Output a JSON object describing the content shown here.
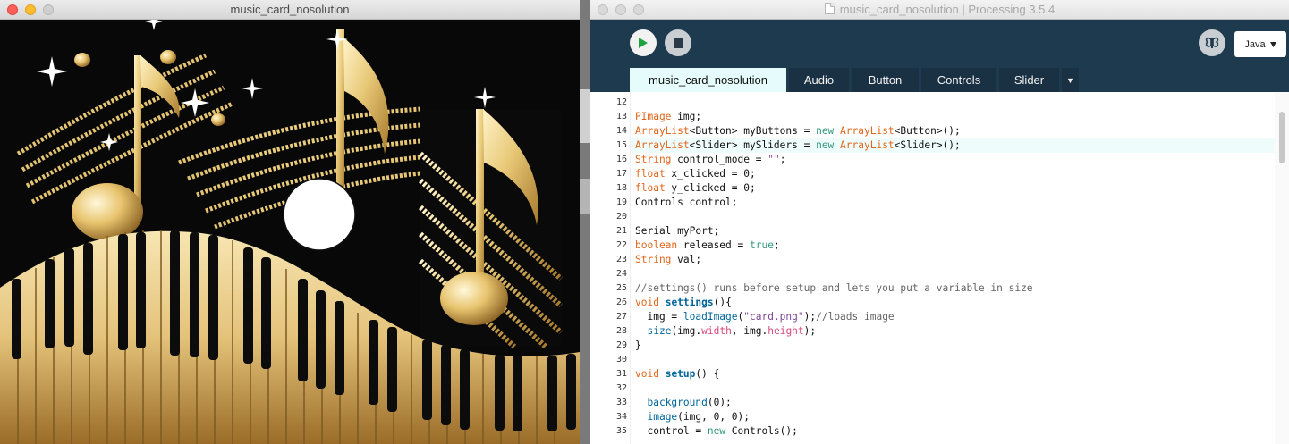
{
  "sketch_window": {
    "title": "music_card_nosolution",
    "canvas": {
      "circle_color": "#ffffff",
      "background_color": "#080808",
      "gold_color": "#e8c978"
    }
  },
  "ide_window": {
    "title": "music_card_nosolution | Processing 3.5.4",
    "toolbar": {
      "run_icon": "play-icon",
      "stop_icon": "stop-icon",
      "debug_icon": "butterfly-debugger-icon",
      "mode_label": "Java",
      "mode_icon": "triangle-down-icon"
    },
    "tabs": [
      {
        "label": "music_card_nosolution",
        "active": true
      },
      {
        "label": "Audio",
        "active": false
      },
      {
        "label": "Button",
        "active": false
      },
      {
        "label": "Controls",
        "active": false
      },
      {
        "label": "Slider",
        "active": false
      }
    ],
    "tab_menu_label": "▼",
    "editor": {
      "highlighted_line": 15,
      "lines": [
        {
          "num": "12",
          "text": ""
        },
        {
          "num": "13",
          "text": "PImage img;"
        },
        {
          "num": "14",
          "text": "ArrayList<Button> myButtons = new ArrayList<Button>();"
        },
        {
          "num": "15",
          "text": "ArrayList<Slider> mySliders = new ArrayList<Slider>();"
        },
        {
          "num": "16",
          "text": "String control_mode = \"\";"
        },
        {
          "num": "17",
          "text": "float x_clicked = 0;"
        },
        {
          "num": "18",
          "text": "float y_clicked = 0;"
        },
        {
          "num": "19",
          "text": "Controls control;"
        },
        {
          "num": "20",
          "text": ""
        },
        {
          "num": "21",
          "text": "Serial myPort;"
        },
        {
          "num": "22",
          "text": "boolean released = true;"
        },
        {
          "num": "23",
          "text": "String val;"
        },
        {
          "num": "24",
          "text": ""
        },
        {
          "num": "25",
          "text": "//settings() runs before setup and lets you put a variable in size"
        },
        {
          "num": "26",
          "text": "void settings(){"
        },
        {
          "num": "27",
          "text": "  img = loadImage(\"card.png\");//loads image"
        },
        {
          "num": "28",
          "text": "  size(img.width, img.height);"
        },
        {
          "num": "29",
          "text": "}"
        },
        {
          "num": "30",
          "text": ""
        },
        {
          "num": "31",
          "text": "void setup() {"
        },
        {
          "num": "32",
          "text": ""
        },
        {
          "num": "33",
          "text": "  background(0);"
        },
        {
          "num": "34",
          "text": "  image(img, 0, 0);"
        },
        {
          "num": "35",
          "text": "  control = new Controls();"
        }
      ]
    }
  }
}
